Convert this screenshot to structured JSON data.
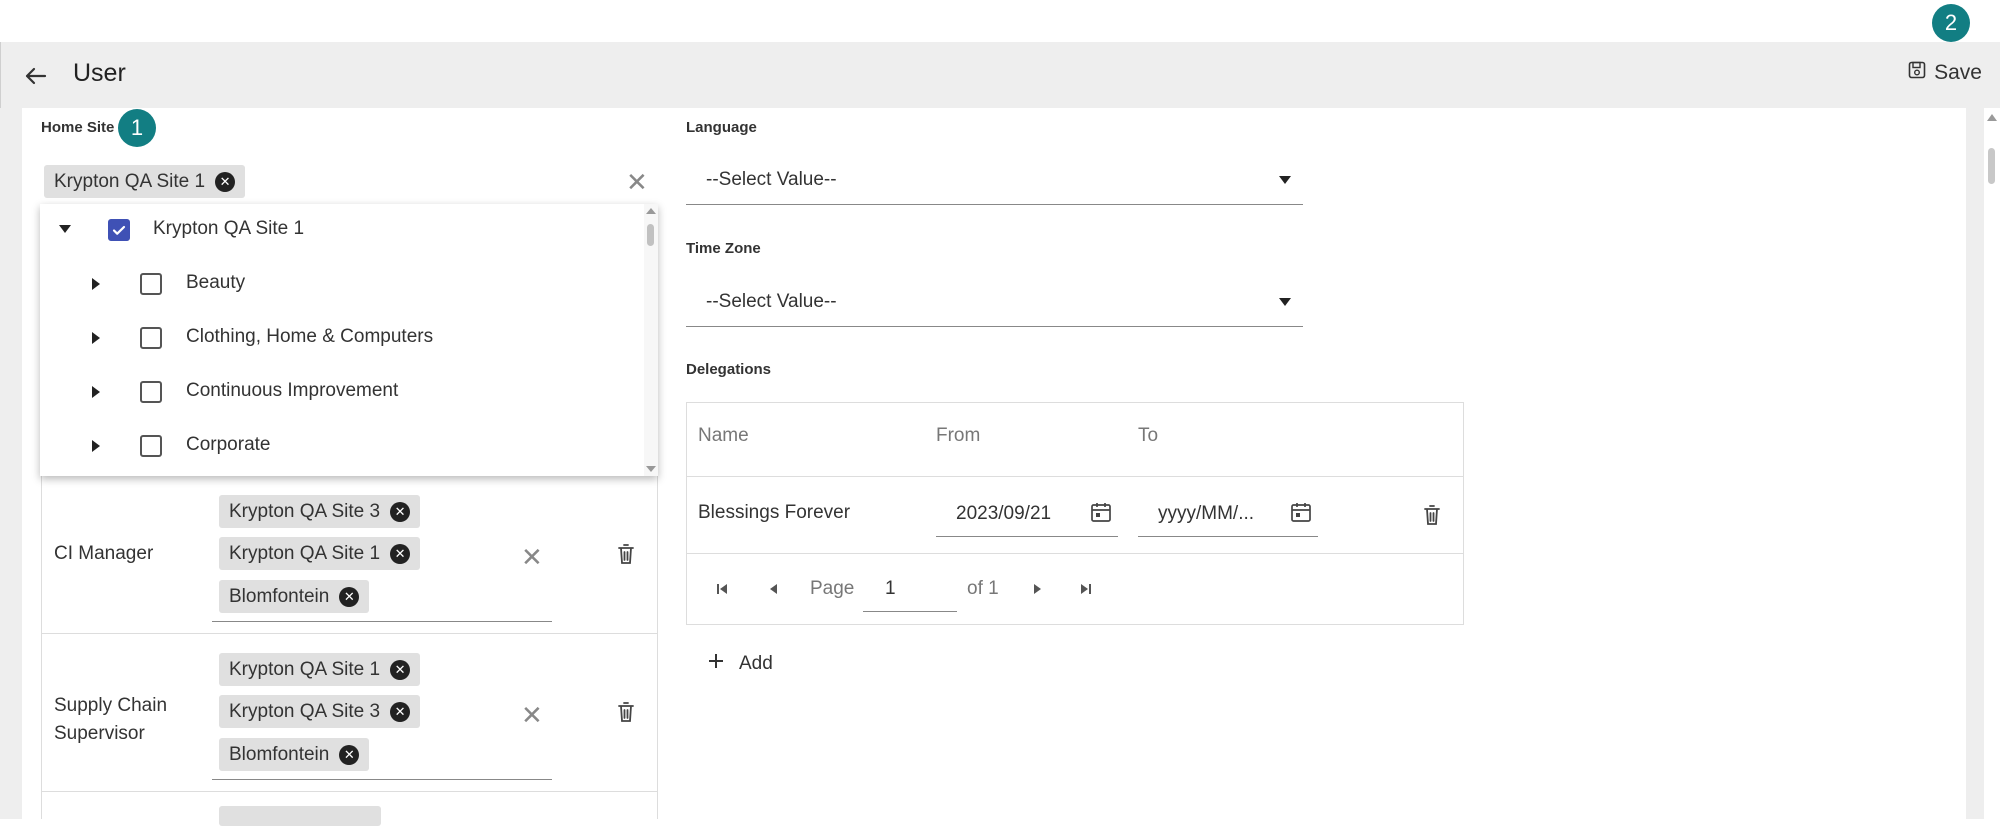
{
  "badges": {
    "first": "1",
    "second": "2"
  },
  "header": {
    "title": "User",
    "save_label": "Save"
  },
  "home_site": {
    "label": "Home Site",
    "selected_chip": "Krypton QA Site 1",
    "tree": [
      {
        "label": "Krypton QA Site 1",
        "checked": true,
        "expanded": true,
        "level": 0
      },
      {
        "label": "Beauty",
        "checked": false,
        "expanded": false,
        "level": 1
      },
      {
        "label": "Clothing, Home & Computers",
        "checked": false,
        "expanded": false,
        "level": 1
      },
      {
        "label": "Continuous Improvement",
        "checked": false,
        "expanded": false,
        "level": 1
      },
      {
        "label": "Corporate",
        "checked": false,
        "expanded": false,
        "level": 1
      }
    ]
  },
  "roles": [
    {
      "name": "CI Manager",
      "sites": [
        "Krypton QA Site 3",
        "Krypton QA Site 1",
        "Blomfontein"
      ]
    },
    {
      "name": "Supply Chain Supervisor",
      "sites": [
        "Krypton QA Site 1",
        "Krypton QA Site 3",
        "Blomfontein"
      ]
    }
  ],
  "language": {
    "label": "Language",
    "value": "--Select Value--"
  },
  "time_zone": {
    "label": "Time Zone",
    "value": "--Select Value--"
  },
  "delegations": {
    "label": "Delegations",
    "columns": {
      "name": "Name",
      "from": "From",
      "to": "To"
    },
    "rows": [
      {
        "name": "Blessings Forever",
        "from": "2023/09/21",
        "to": "yyyy/MM/..."
      }
    ],
    "pager": {
      "page_label": "Page",
      "page": "1",
      "of_label": "of 1"
    },
    "add_label": "Add"
  },
  "colors": {
    "accent": "#127e83",
    "checkbox": "#3f51b5",
    "focus_underline": "#3f51b5"
  }
}
